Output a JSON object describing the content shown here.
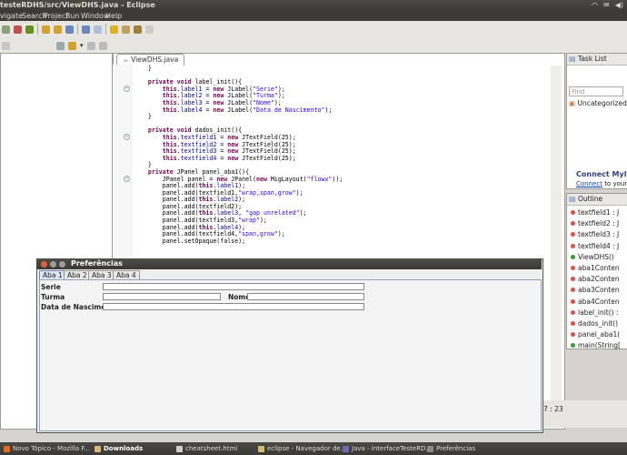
{
  "window": {
    "title": "testeRDHS/src/ViewDHS.java - Eclipse"
  },
  "menubar": {
    "items": [
      "vigate",
      "Search",
      "Project",
      "Run",
      "Window",
      "Help"
    ]
  },
  "editor": {
    "tab_label": "ViewDHS.java",
    "code_lines": [
      "    }",
      "",
      "    private void label_init(){",
      "        this.label1 = new JLabel(\"Serie\");",
      "        this.label2 = new JLabel(\"Turma\");",
      "        this.label3 = new JLabel(\"Nome\");",
      "        this.label4 = new JLabel(\"Data de Nascimento\");",
      "    }",
      "",
      "    private void dados_init(){",
      "        this.textfield1 = new JTextField(25);",
      "        this.textfield2 = new JTextField(25);",
      "        this.textfield3 = new JTextField(25);",
      "        this.textfield4 = new JTextField(25);",
      "    }",
      "    private JPanel panel_aba1(){",
      "        JPanel panel = new JPanel(new MigLayout(\"flowx\"));",
      "        panel.add(this.label1);",
      "        panel.add(textfield1,\"wrap,span,grow\");",
      "        panel.add(this.label2);",
      "        panel.add(textfield2);",
      "        panel.add(this.label3, \"gap unrelated\");",
      "        panel.add(textfield3,\"wrap\");",
      "        panel.add(this.label4);",
      "        panel.add(textfield4,\"span,grow\");",
      "        panel.setOpaque(false);"
    ]
  },
  "task_list": {
    "title": "Task List",
    "find_placeholder": "Find",
    "uncategorized": "Uncategorized",
    "connect_title": "Connect Myly",
    "connect_link": "Connect",
    "connect_rest": "to your ta"
  },
  "outline": {
    "title": "Outline",
    "items": [
      {
        "label": "textfield1 : J",
        "color": "#d9534f"
      },
      {
        "label": "textfield2 : J",
        "color": "#d9534f"
      },
      {
        "label": "textfield3 : J",
        "color": "#d9534f"
      },
      {
        "label": "textfield4 : J",
        "color": "#d9534f"
      },
      {
        "label": "ViewDHS()",
        "color": "#3a9a3a"
      },
      {
        "label": "aba1Conten",
        "color": "#d9534f"
      },
      {
        "label": "aba2Conten",
        "color": "#d9534f"
      },
      {
        "label": "aba3Conten",
        "color": "#d9534f"
      },
      {
        "label": "aba4Conten",
        "color": "#d9534f"
      },
      {
        "label": "label_init() :",
        "color": "#d9534f"
      },
      {
        "label": "dados_init()",
        "color": "#d9534f"
      },
      {
        "label": "panel_aba1(",
        "color": "#d9534f"
      },
      {
        "label": "main(String[",
        "color": "#3a9a3a"
      }
    ]
  },
  "status": {
    "position": "7 : 23"
  },
  "dialog": {
    "title": "Preferências",
    "tabs": [
      "Aba 1",
      "Aba 2",
      "Aba 3",
      "Aba 4"
    ],
    "active_tab": "Aba 1",
    "fields": {
      "serie_label": "Serie",
      "turma_label": "Turma",
      "nome_label": "Nome",
      "nascimento_label": "Data de Nascimento"
    }
  },
  "taskbar": {
    "items": [
      {
        "label": "Novo Tópico - Mozilla F...",
        "color": "#e66b1c"
      },
      {
        "label": "Downloads",
        "color": "#d8b97a",
        "active": true
      },
      {
        "label": "cheatsheet.html",
        "color": "#cfcfcf"
      },
      {
        "label": "eclipse - Navegador de...",
        "color": "#d8b97a"
      },
      {
        "label": "Java - InterfaceTesteRD...",
        "color": "#6a6ab0"
      },
      {
        "label": "Preferências",
        "color": "#8a8a8a"
      }
    ]
  }
}
